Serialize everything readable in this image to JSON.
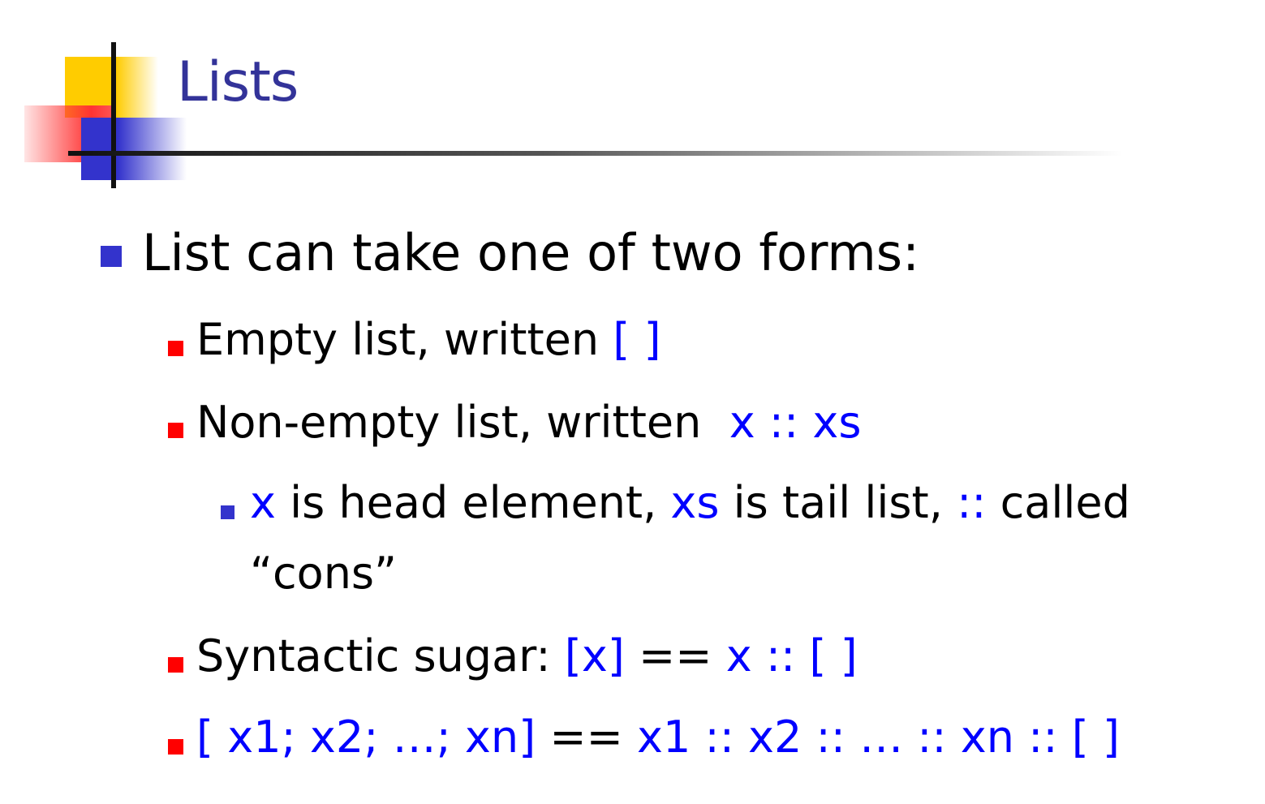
{
  "slide": {
    "title": "Lists",
    "line1": "List can take one of two forms:",
    "line2": {
      "text": "Empty list, written ",
      "code": "[ ]"
    },
    "line3": {
      "text": "Non-empty list, written  ",
      "code": "x :: xs"
    },
    "line4": {
      "c1": "x",
      "t1": " is head element, ",
      "c2": "xs",
      "t2": " is tail list, ",
      "c3": "::",
      "t3": " called"
    },
    "line5": "“cons”",
    "line6": {
      "text": "Syntactic sugar: ",
      "c1": "[x]",
      "t1": " == ",
      "c2": "x :: [ ]"
    },
    "line7": {
      "c1": "[ x1; x2; …; xn]",
      "t1": " == ",
      "c2": "x1 :: x2 :: … :: xn :: [ ]"
    }
  },
  "colors": {
    "title": "#333399",
    "code": "#0000ff",
    "level1_bullet": "#3333cc",
    "level2_bullet": "#ff0000",
    "level3_bullet": "#3333cc"
  }
}
